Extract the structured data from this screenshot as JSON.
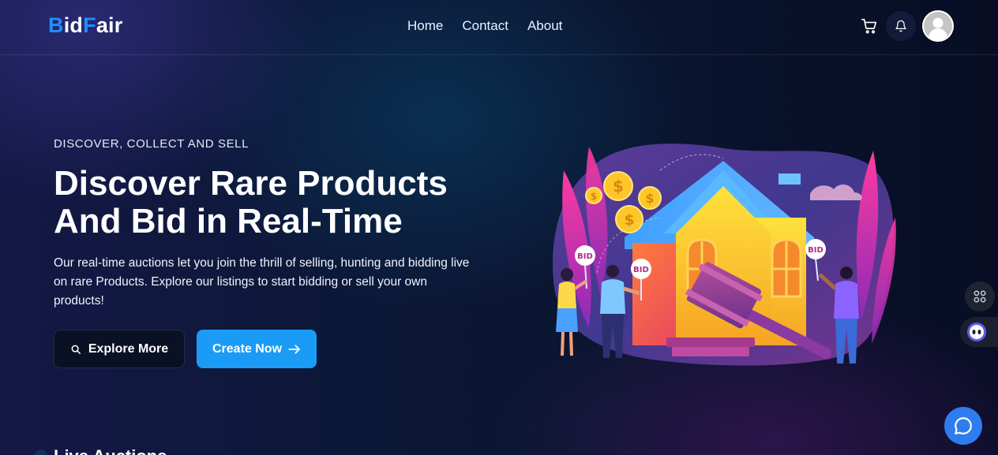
{
  "header": {
    "logo": {
      "part1_letter": "B",
      "part2": "id",
      "part3_letter": "F",
      "part4": "air"
    },
    "nav": [
      {
        "label": "Home"
      },
      {
        "label": "Contact"
      },
      {
        "label": "About"
      }
    ],
    "icons": {
      "cart": "cart-icon",
      "bell": "bell-icon",
      "avatar": "user-avatar-icon"
    }
  },
  "hero": {
    "eyebrow": "DISCOVER, COLLECT AND SELL",
    "title_line1": "Discover Rare Products",
    "title_line2": "And Bid in Real-Time",
    "description": "Our real-time auctions let you join the thrill of selling, hunting and bidding live on rare Products. Explore our listings to start bidding or sell your own products!",
    "explore_label": "Explore More",
    "create_label": "Create Now",
    "illustration": {
      "bid_tag_1": "BID",
      "bid_tag_2": "BID",
      "bid_tag_3": "BID"
    }
  },
  "section": {
    "heading": "Live Auctions"
  },
  "colors": {
    "accent": "#1a9bf6",
    "logo_blue": "#1e90ff",
    "chat": "#2e7df0"
  }
}
